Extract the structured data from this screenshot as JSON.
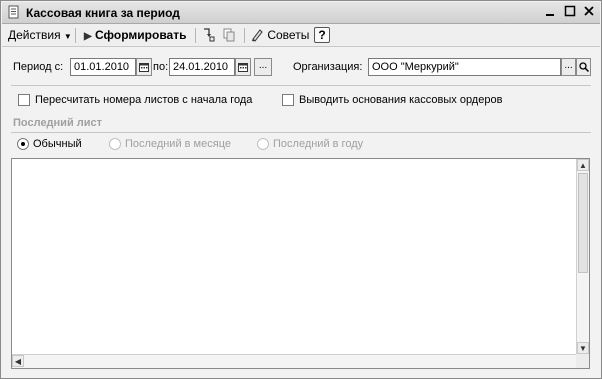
{
  "window": {
    "title": "Кассовая книга за период",
    "icons": {
      "title_icon": "document-icon",
      "minimize": "minimize-icon",
      "maximize": "maximize-icon",
      "close": "close-icon"
    }
  },
  "toolbar": {
    "actions_label": "Действия",
    "generate_label": "Сформировать",
    "tips_label": "Советы",
    "help_label": "?"
  },
  "period": {
    "from_label": "Период с:",
    "from_value": "01.01.2010",
    "to_label": "по:",
    "to_value": "24.01.2010",
    "more_button": "..."
  },
  "organization": {
    "label": "Организация:",
    "value": "ООО \"Меркурий\"",
    "select_button": "..."
  },
  "options": {
    "renumber_label": "Пересчитать номера листов с начала года",
    "renumber_checked": false,
    "show_reasons_label": "Выводить основания кассовых ордеров",
    "show_reasons_checked": false
  },
  "last_sheet": {
    "section_title": "Последний лист",
    "radios": [
      {
        "label": "Обычный",
        "selected": true,
        "enabled": true
      },
      {
        "label": "Последний в месяце",
        "selected": false,
        "enabled": false
      },
      {
        "label": "Последний в году",
        "selected": false,
        "enabled": false
      }
    ]
  },
  "result": {
    "content": ""
  }
}
